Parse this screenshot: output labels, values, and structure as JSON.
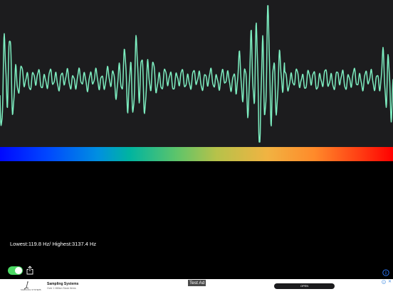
{
  "waveform": {
    "color": "#7dedc0",
    "background": "#1c1c1e"
  },
  "spectrum": {
    "stops": [
      "#0008ff",
      "#0090e0",
      "#5ec46a",
      "#f1b342",
      "#ff3a12",
      "#ff0000"
    ]
  },
  "readout": {
    "text": "Lowest:119.8     Hz/ Highest:3137.4   Hz"
  },
  "controls": {
    "toggle_on": true,
    "toggle_color": "#4cd964"
  },
  "ad": {
    "test_label": "Test Ad",
    "title": "Sampling Systems",
    "subtitle": "Over 1 Million Stock Items",
    "logo_caption": "SAMPLING SYSTEMS",
    "open_label": "OPEN",
    "close_glyph": "✕"
  },
  "icons": {
    "share": "share-icon",
    "info": "info-icon",
    "adchoices": "adchoices-icon"
  }
}
